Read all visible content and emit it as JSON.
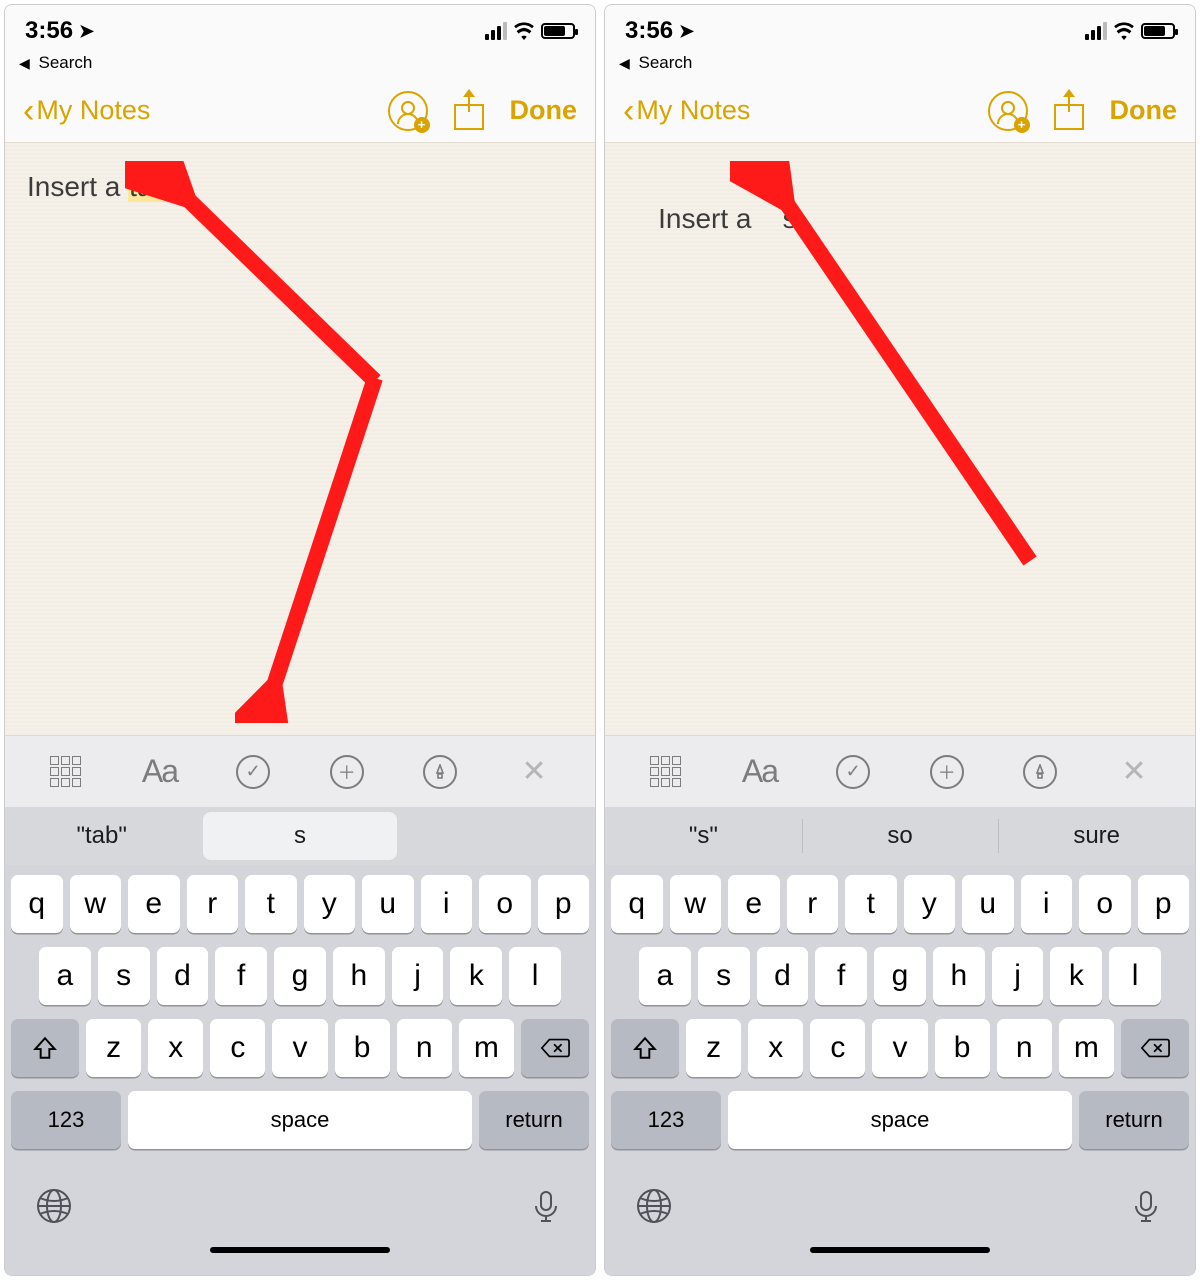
{
  "accent_color": "#d9a300",
  "arrow_color": "#ff1a1a",
  "left": {
    "status": {
      "time": "3:56",
      "breadcrumb": "Search"
    },
    "nav": {
      "back": "My Notes",
      "done": "Done"
    },
    "note": {
      "prefix": "Insert a ",
      "highlighted": "tab"
    },
    "accessory": {
      "aa": "Aa"
    },
    "suggestions": [
      "\"tab\"",
      "s",
      ""
    ],
    "suggestion_selected_index": 1,
    "keyboard": {
      "row1": [
        "q",
        "w",
        "e",
        "r",
        "t",
        "y",
        "u",
        "i",
        "o",
        "p"
      ],
      "row2": [
        "a",
        "s",
        "d",
        "f",
        "g",
        "h",
        "j",
        "k",
        "l"
      ],
      "row3": [
        "z",
        "x",
        "c",
        "v",
        "b",
        "n",
        "m"
      ],
      "numkey": "123",
      "space": "space",
      "return": "return"
    }
  },
  "right": {
    "status": {
      "time": "3:56",
      "breadcrumb": "Search"
    },
    "nav": {
      "back": "My Notes",
      "done": "Done"
    },
    "note": {
      "text": "Insert a    s"
    },
    "accessory": {
      "aa": "Aa"
    },
    "suggestions": [
      "\"s\"",
      "so",
      "sure"
    ],
    "suggestion_selected_index": -1,
    "keyboard": {
      "row1": [
        "q",
        "w",
        "e",
        "r",
        "t",
        "y",
        "u",
        "i",
        "o",
        "p"
      ],
      "row2": [
        "a",
        "s",
        "d",
        "f",
        "g",
        "h",
        "j",
        "k",
        "l"
      ],
      "row3": [
        "z",
        "x",
        "c",
        "v",
        "b",
        "n",
        "m"
      ],
      "numkey": "123",
      "space": "space",
      "return": "return"
    }
  }
}
